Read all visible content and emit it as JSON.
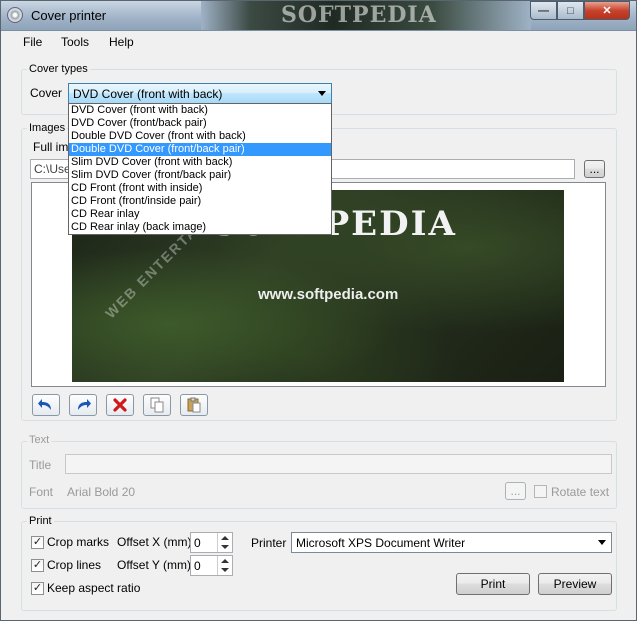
{
  "window": {
    "title": "Cover printer",
    "banner_text": "SOFTPEDIA",
    "controls": {
      "minimize": "—",
      "maximize": "□",
      "close": "✕"
    }
  },
  "menu": [
    "File",
    "Tools",
    "Help"
  ],
  "cover_types": {
    "group_label": "Cover types",
    "cover_label": "Cover",
    "selected": "DVD Cover (front with back)",
    "options": [
      "DVD Cover (front with back)",
      "DVD Cover (front/back pair)",
      "Double DVD Cover (front with back)",
      "Double DVD Cover (front/back pair)",
      "Slim DVD Cover (front with back)",
      "Slim DVD Cover (front/back pair)",
      "CD Front (front with inside)",
      "CD Front (front/inside pair)",
      "CD Rear inlay",
      "CD Rear inlay (back image)"
    ],
    "highlighted_index": 3
  },
  "images": {
    "group_label": "Images",
    "tab_label": "Full ima",
    "path_value": "C:\\User",
    "browse_label": "...",
    "image_logo_text": "SOFTPEDIA",
    "image_url_text": "www.softpedia.com",
    "image_side_text": "WEB ENTERTAINMENT"
  },
  "toolbar": {
    "icons": [
      "undo-icon",
      "redo-icon",
      "delete-icon",
      "copy-icon",
      "paste-icon"
    ],
    "colors": {
      "arrow": "#1a56b8",
      "delete": "#d01818"
    }
  },
  "text_section": {
    "group_label": "Text",
    "title_label": "Title",
    "title_value": "",
    "font_label": "Font",
    "font_value": "Arial Bold 20",
    "font_button": "...",
    "rotate_label": "Rotate text",
    "rotate_checked": false
  },
  "print": {
    "group_label": "Print",
    "crop_marks_label": "Crop marks",
    "crop_marks_checked": true,
    "crop_lines_label": "Crop lines",
    "crop_lines_checked": true,
    "keep_aspect_label": "Keep aspect ratio",
    "keep_aspect_checked": true,
    "offset_x_label": "Offset X (mm)",
    "offset_x_value": "0",
    "offset_y_label": "Offset Y (mm)",
    "offset_y_value": "0",
    "printer_label": "Printer",
    "printer_value": "Microsoft XPS Document Writer",
    "print_button": "Print",
    "preview_button": "Preview",
    "check_mark": "✓"
  }
}
